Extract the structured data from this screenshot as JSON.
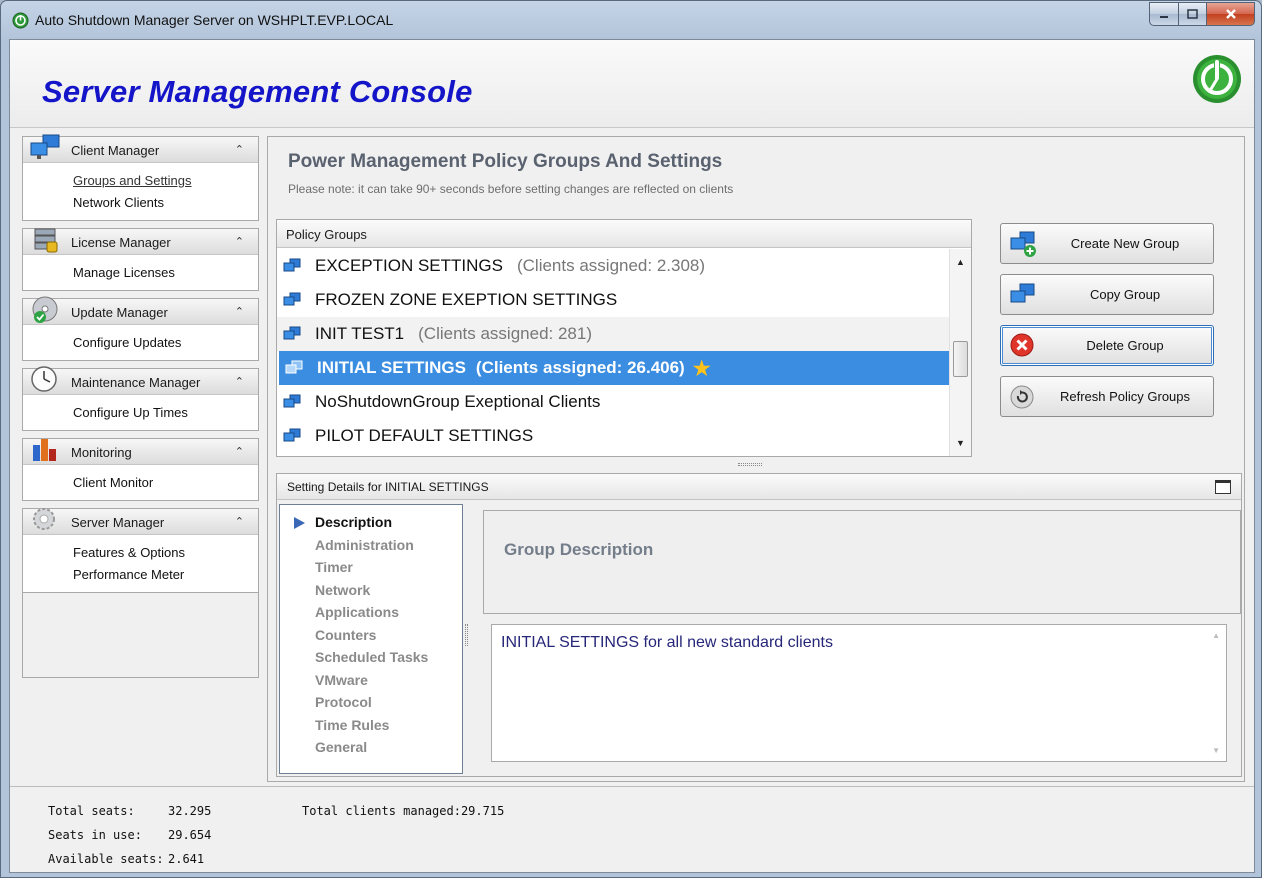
{
  "window": {
    "title": "Auto Shutdown Manager Server on WSHPLT.EVP.LOCAL",
    "icon": "power-icon"
  },
  "header": {
    "app_title": "Server Management Console",
    "logo": "power-logo-icon"
  },
  "nav": {
    "sections": [
      {
        "label": "Client Manager",
        "icon": "monitors-icon",
        "links": [
          "Groups and Settings",
          "Network Clients"
        ],
        "active": "Groups and Settings"
      },
      {
        "label": "License Manager",
        "icon": "license-server-icon",
        "links": [
          "Manage Licenses"
        ]
      },
      {
        "label": "Update  Manager",
        "icon": "update-disc-icon",
        "links": [
          "Configure Updates"
        ]
      },
      {
        "label": "Maintenance Manager",
        "icon": "clock-icon",
        "links": [
          "Configure Up Times"
        ]
      },
      {
        "label": "Monitoring",
        "icon": "bar-chart-icon",
        "links": [
          "Client Monitor"
        ]
      },
      {
        "label": "Server Manager",
        "icon": "gears-icon",
        "links": [
          "Features & Options",
          "Performance Meter"
        ]
      }
    ]
  },
  "main": {
    "title": "Power Management Policy Groups And Settings",
    "note": "Please note: it can take 90+ seconds before setting changes are reflected on clients",
    "policy_groups": {
      "header": "Policy Groups",
      "rows": [
        {
          "name": "EXCEPTION SETTINGS",
          "count": "(Clients assigned: 2.308)"
        },
        {
          "name": "FROZEN ZONE EXEPTION SETTINGS",
          "count": ""
        },
        {
          "name": "INIT TEST1",
          "count": "(Clients assigned: 281)"
        },
        {
          "name": "INITIAL SETTINGS",
          "count": "(Clients assigned: 26.406)",
          "selected": true,
          "star": "★"
        },
        {
          "name": "NoShutdownGroup Exeptional Clients",
          "count": ""
        },
        {
          "name": "PILOT DEFAULT SETTINGS",
          "count": ""
        }
      ]
    },
    "buttons": {
      "create": "Create New Group",
      "copy": "Copy  Group",
      "delete": "Delete Group",
      "refresh": "Refresh Policy Groups"
    },
    "details": {
      "header": "Setting Details for INITIAL SETTINGS",
      "nav_items": [
        "Description",
        "Administration",
        "Timer",
        "Network",
        "Applications",
        "Counters",
        "Scheduled Tasks",
        "VMware",
        "Protocol",
        "Time Rules",
        "General"
      ],
      "active_item": "Description",
      "section_title": "Group Description",
      "description_text": "INITIAL SETTINGS for all new standard clients"
    }
  },
  "footer": {
    "total_seats_label": "Total seats:",
    "total_seats": "32.295",
    "seats_in_use_label": "Seats in use:",
    "seats_in_use": "29.654",
    "available_seats_label": "Available seats:",
    "available_seats": "2.641",
    "total_clients_label": "Total clients managed:",
    "total_clients": "29.715"
  },
  "colors": {
    "title_blue": "#1414c8",
    "selection": "#3a8de0",
    "star": "#ffc21a",
    "delete_red": "#e0352b"
  }
}
